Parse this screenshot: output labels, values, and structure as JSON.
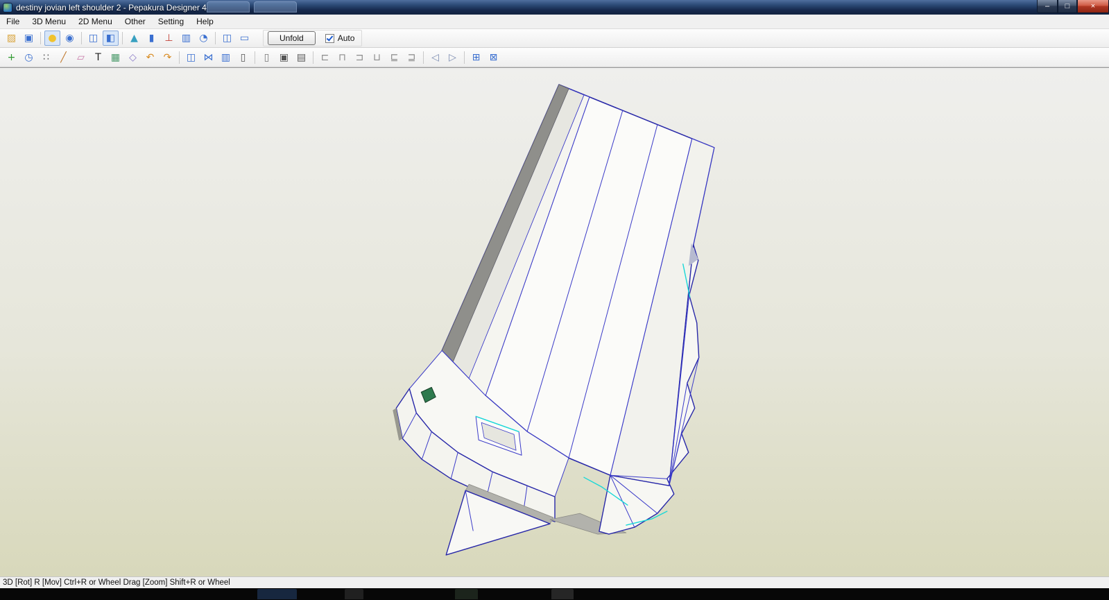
{
  "window": {
    "title": "destiny jovian left shoulder 2 - Pepakura Designer 4",
    "controls": {
      "minimize": "–",
      "maximize": "□",
      "close": "×"
    }
  },
  "menu": {
    "items": [
      {
        "label": "File"
      },
      {
        "label": "3D Menu"
      },
      {
        "label": "2D Menu"
      },
      {
        "label": "Other"
      },
      {
        "label": "Setting"
      },
      {
        "label": "Help"
      }
    ]
  },
  "toolbar1": {
    "icons": [
      {
        "name": "open-file-icon",
        "glyph": "▨",
        "color": "#d9a43c"
      },
      {
        "name": "save-icon",
        "glyph": "▣",
        "color": "#3a6fd0"
      },
      {
        "sep": true
      },
      {
        "name": "light-toggle-icon",
        "glyph": "●",
        "color": "#f0c22e",
        "pressed": true
      },
      {
        "name": "rotate-view-icon",
        "glyph": "◉",
        "color": "#3a6fd0"
      },
      {
        "sep": true
      },
      {
        "name": "select-box-icon",
        "glyph": "◫",
        "color": "#3a6fd0"
      },
      {
        "name": "select-face-icon",
        "glyph": "◧",
        "color": "#3a6fd0",
        "pressed": true
      },
      {
        "sep": true
      },
      {
        "name": "cone-primitive-icon",
        "glyph": "▲",
        "color": "#38a0c0"
      },
      {
        "name": "cylinder-primitive-icon",
        "glyph": "▮",
        "color": "#3a6fd0"
      },
      {
        "name": "axis-icon",
        "glyph": "⊥",
        "color": "#c24036"
      },
      {
        "name": "texture-view-icon",
        "glyph": "▥",
        "color": "#3a6fd0"
      },
      {
        "name": "zoom-rotate-icon",
        "glyph": "◔",
        "color": "#3a6fd0"
      },
      {
        "sep": true
      },
      {
        "name": "layout-both-windows-icon",
        "glyph": "◫",
        "color": "#3a6fd0"
      },
      {
        "name": "layout-2d-window-icon",
        "glyph": "▭",
        "color": "#3a6fd0"
      }
    ],
    "unfold_label": "Unfold",
    "auto_label": "Auto",
    "auto_checked": true
  },
  "toolbar2": {
    "icons": [
      {
        "name": "pan-tool-icon",
        "glyph": "+",
        "color": "#2f9a2f"
      },
      {
        "name": "measure-icon",
        "glyph": "◷",
        "color": "#3a6fd0"
      },
      {
        "name": "snap-grid-icon",
        "glyph": "∷",
        "color": "#5a5a5a"
      },
      {
        "name": "draw-line-icon",
        "glyph": "╱",
        "color": "#c07a30"
      },
      {
        "name": "eraser-icon",
        "glyph": "▱",
        "color": "#c878a8"
      },
      {
        "name": "text-tool-icon",
        "glyph": "T",
        "color": "#222222"
      },
      {
        "name": "image-insert-icon",
        "glyph": "▦",
        "color": "#4a9a6a"
      },
      {
        "name": "box-tool-icon",
        "glyph": "◇",
        "color": "#8a7ac8"
      },
      {
        "name": "undo-icon",
        "glyph": "↶",
        "color": "#d88a20"
      },
      {
        "name": "redo-icon",
        "glyph": "↷",
        "color": "#d88a20"
      },
      {
        "sep": true
      },
      {
        "name": "book-view-icon",
        "glyph": "◫",
        "color": "#3a6fd0"
      },
      {
        "name": "pattern-cut-icon",
        "glyph": "⋈",
        "color": "#3a6fd0"
      },
      {
        "name": "chart-icon",
        "glyph": "▥",
        "color": "#3a6fd0"
      },
      {
        "name": "page-setup-icon",
        "glyph": "▯",
        "color": "#555555"
      },
      {
        "sep": true
      },
      {
        "name": "export-page-icon",
        "glyph": "▯",
        "color": "#777777"
      },
      {
        "name": "capture-icon",
        "glyph": "▣",
        "color": "#555555"
      },
      {
        "name": "print-icon",
        "glyph": "▤",
        "color": "#555555"
      },
      {
        "sep": true
      },
      {
        "name": "align-left-icon",
        "glyph": "⊏",
        "color": "#8a8a8a"
      },
      {
        "name": "align-center-h-icon",
        "glyph": "⊓",
        "color": "#8a8a8a"
      },
      {
        "name": "align-right-icon",
        "glyph": "⊐",
        "color": "#8a8a8a"
      },
      {
        "name": "align-top-icon",
        "glyph": "⊔",
        "color": "#8a8a8a"
      },
      {
        "name": "align-middle-icon",
        "glyph": "⊑",
        "color": "#8a8a8a"
      },
      {
        "name": "align-bottom-icon",
        "glyph": "⊒",
        "color": "#8a8a8a"
      },
      {
        "sep": true
      },
      {
        "name": "flip-left-icon",
        "glyph": "◁",
        "color": "#7a8ab0"
      },
      {
        "name": "flip-right-icon",
        "glyph": "▷",
        "color": "#7a8ab0"
      },
      {
        "sep": true
      },
      {
        "name": "arrange-parts-icon",
        "glyph": "⊞",
        "color": "#3a6fd0"
      },
      {
        "name": "arrange-all-icon",
        "glyph": "⊠",
        "color": "#3a6fd0"
      }
    ]
  },
  "viewport": {
    "colors": {
      "bg_top": "#efefed",
      "bg_bottom": "#d8d8bb",
      "edge": "#3a3ac8",
      "edge_dark": "#2828a8",
      "cyan": "#18d8d8",
      "face": "#fbfbf9",
      "gray_strip": "#8f8f8b",
      "gray_band": "#b2b2ac"
    }
  },
  "statusbar": {
    "text": "3D [Rot] R [Mov] Ctrl+R or Wheel Drag [Zoom] Shift+R or Wheel"
  }
}
